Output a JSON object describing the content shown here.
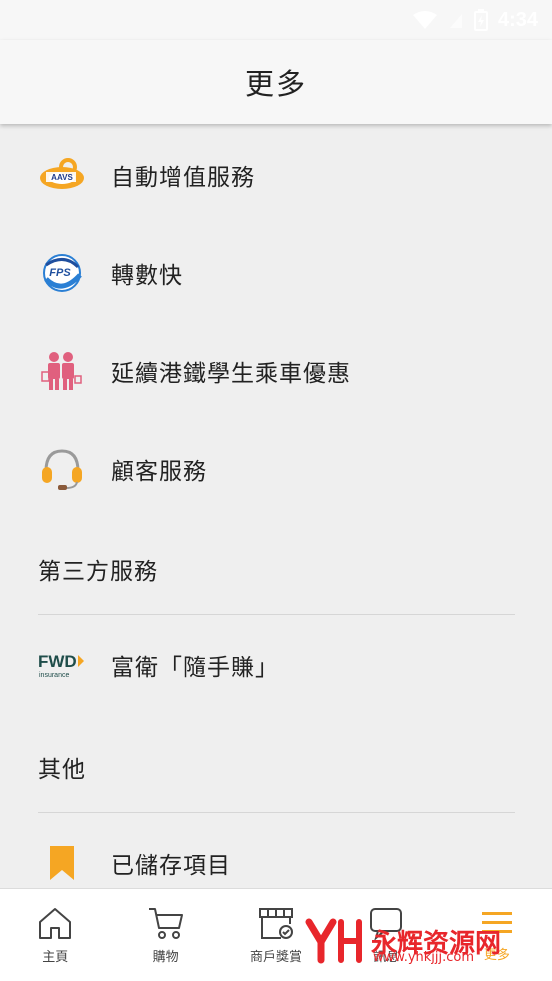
{
  "status_bar": {
    "time": "4:34"
  },
  "header": {
    "title": "更多"
  },
  "menu": {
    "items": [
      {
        "label": "自動增值服務",
        "icon": "aavs-icon"
      },
      {
        "label": "轉數快",
        "icon": "fps-icon"
      },
      {
        "label": "延續港鐵學生乘車優惠",
        "icon": "students-icon"
      },
      {
        "label": "顧客服務",
        "icon": "headset-icon"
      }
    ],
    "third_party": {
      "section_title": "第三方服務",
      "items": [
        {
          "label": "富衛「隨手賺」",
          "icon": "fwd-insurance-icon",
          "logo_text": "FWD",
          "logo_sub": "insurance"
        }
      ]
    },
    "others": {
      "section_title": "其他",
      "items": [
        {
          "label": "已儲存項目",
          "icon": "bookmark-icon"
        }
      ]
    }
  },
  "bottom_nav": {
    "items": [
      {
        "label": "主頁",
        "icon": "home-icon"
      },
      {
        "label": "購物",
        "icon": "cart-icon"
      },
      {
        "label": "商戶獎賞",
        "icon": "store-icon"
      },
      {
        "label": "訊息",
        "icon": "message-icon"
      },
      {
        "label": "更多",
        "icon": "menu-icon"
      }
    ],
    "active_index": 4
  },
  "aavs_logo_text": "AAVS",
  "fps_logo_text": "FPS",
  "watermark": {
    "text": "永辉资源网",
    "url": "www.yhkjjj.com"
  },
  "colors": {
    "accent": "#f5a623",
    "text": "#222222",
    "background": "#efefef"
  }
}
